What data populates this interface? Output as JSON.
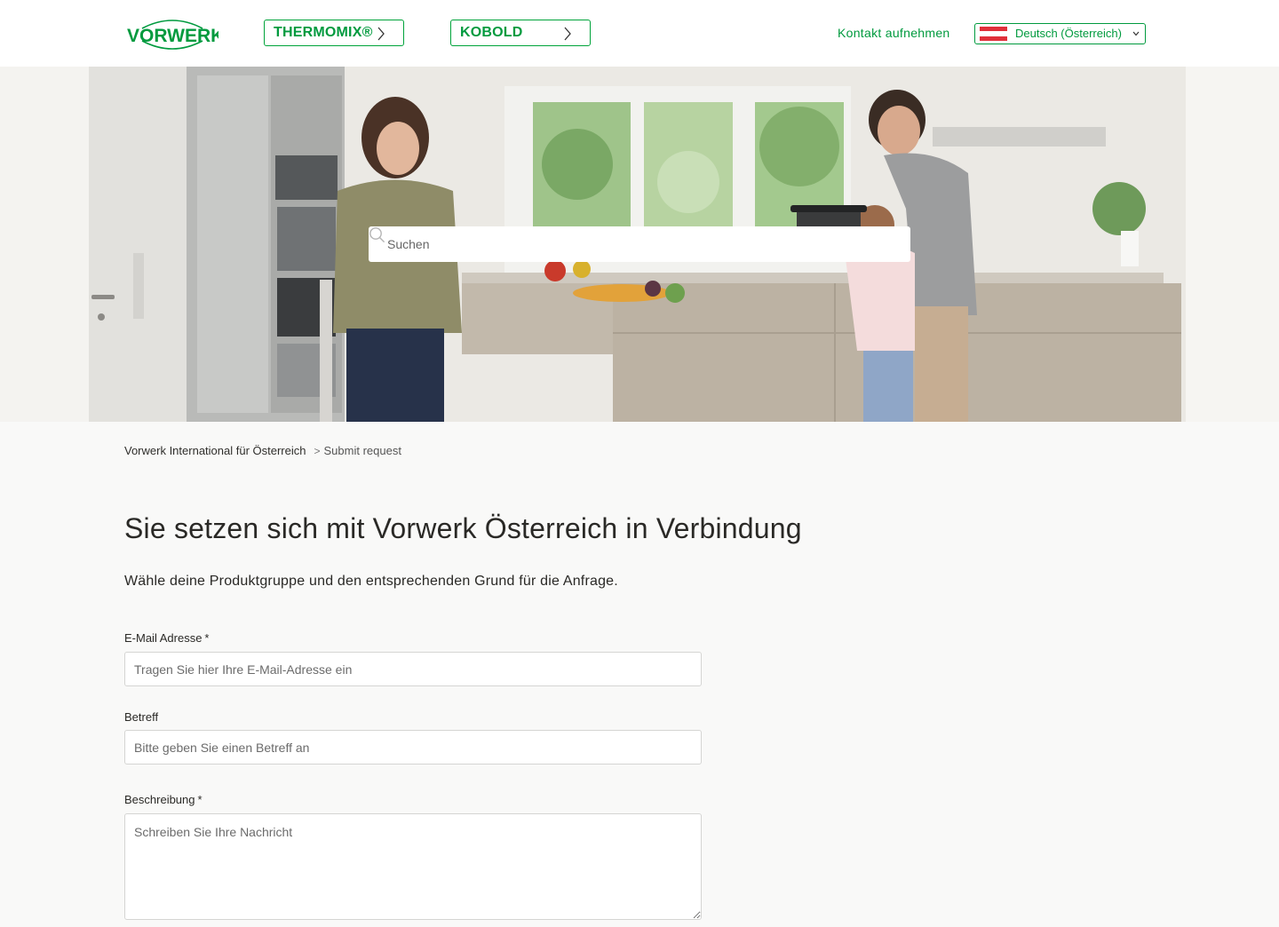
{
  "header": {
    "logo_text": "VORWERK",
    "brand_links": [
      {
        "label": "THERMOMIX®"
      },
      {
        "label": "KOBOLD"
      }
    ],
    "contact_label": "Kontakt aufnehmen",
    "language": {
      "selected": "Deutsch (Österreich)",
      "flag": "austria-flag"
    }
  },
  "hero": {
    "search_placeholder": "Suchen"
  },
  "breadcrumb": {
    "home": "Vorwerk International für Österreich",
    "separator": ">",
    "current": "Submit request"
  },
  "main": {
    "title": "Sie setzen sich mit Vorwerk Österreich in Verbindung",
    "intro": "Wähle deine Produktgruppe und den entsprechenden Grund für die Anfrage."
  },
  "form": {
    "email": {
      "label": "E-Mail Adresse",
      "required_mark": "*",
      "placeholder": "Tragen Sie hier Ihre E-Mail-Adresse ein"
    },
    "subject": {
      "label": "Betreff",
      "placeholder": "Bitte geben Sie einen Betreff an"
    },
    "description": {
      "label": "Beschreibung",
      "required_mark": "*",
      "placeholder": "Schreiben Sie Ihre Nachricht"
    }
  },
  "colors": {
    "brand_green": "#009a3e",
    "flag_red": "#e0303a",
    "page_bg": "#f9f9f8"
  }
}
